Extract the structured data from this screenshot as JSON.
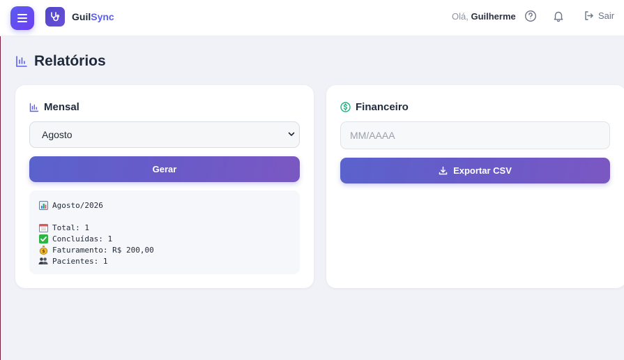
{
  "header": {
    "brand_part1": "Guil",
    "brand_part2": "Sync",
    "greeting_prefix": "Olá,",
    "user_name": "Guilherme",
    "logout_label": "Sair"
  },
  "page": {
    "title": "Relatórios"
  },
  "monthly_card": {
    "title": "Mensal",
    "selected_month": "Agosto",
    "generate_label": "Gerar",
    "report": {
      "heading": "Agosto/2026",
      "total": "Total: 1",
      "completed": "Concluídas: 1",
      "revenue": "Faturamento: R$ 200,00",
      "patients": "Pacientes: 1"
    }
  },
  "financial_card": {
    "title": "Financeiro",
    "period_placeholder": "MM/AAAA",
    "export_label": "Exportar CSV"
  },
  "colors": {
    "accent": "#5b5ff0",
    "button_gradient_start": "#5a62cc",
    "button_gradient_end": "#7b58c2",
    "financial_icon": "#10b981"
  },
  "icons": {
    "menu": "hamburger-icon",
    "logo": "stethoscope-icon",
    "help": "question-circle-icon",
    "notifications": "bell-icon",
    "logout": "logout-icon",
    "reports": "bar-chart-icon",
    "financial": "dollar-circle-icon",
    "export": "download-icon"
  }
}
